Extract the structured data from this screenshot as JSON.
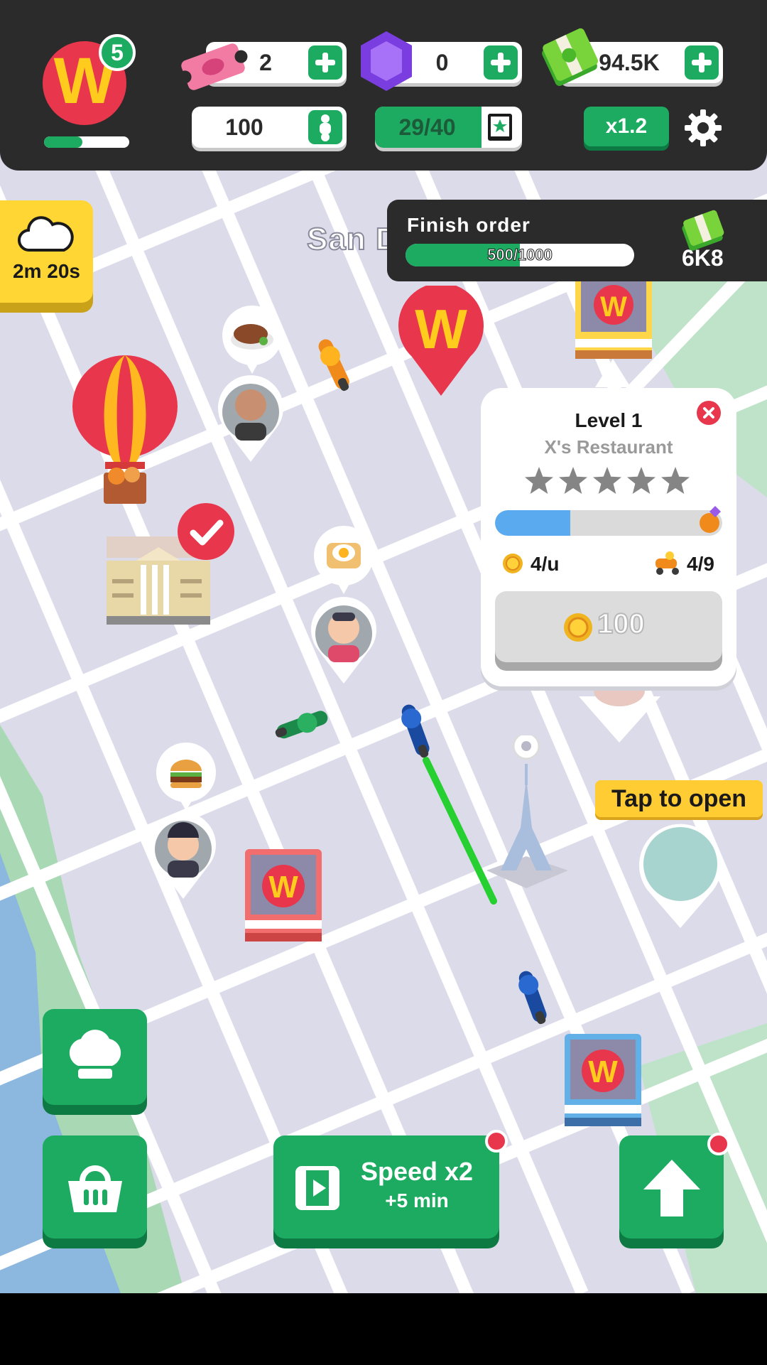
{
  "player": {
    "level": "5",
    "logo_letter": "W",
    "xp_progress": 0.45
  },
  "resources": {
    "tickets": {
      "value": "2",
      "icon": "ticket-icon"
    },
    "gems": {
      "value": "0",
      "icon": "gem-icon"
    },
    "cash": {
      "value": "94.5K",
      "icon": "cash-icon"
    }
  },
  "stats": {
    "riders": "100",
    "collection": "29/40",
    "collection_progress": 0.725,
    "multiplier": "x1.2"
  },
  "event_timer": {
    "value": "2m 20s",
    "icon": "cloud-icon"
  },
  "map": {
    "city_label": "San D"
  },
  "finish_order": {
    "title": "Finish order",
    "progress_text": "500/1000",
    "progress": 0.5,
    "reward": "6K8"
  },
  "restaurant_popup": {
    "level": "Level 1",
    "name": "X's Restaurant",
    "stars_filled": 0,
    "stars_total": 5,
    "upgrade_progress": 0.33,
    "income": "4/u",
    "riders": "4/9",
    "cost": "100"
  },
  "tap_to_open": "Tap to open",
  "speed_button": {
    "title": "Speed x2",
    "subtitle": "+5 min"
  },
  "colors": {
    "brand_red": "#e8364c",
    "brand_yellow": "#ffcc1d",
    "green": "#1cab61",
    "road_bg": "#dcdbea",
    "progress_blue": "#5aaaf0"
  }
}
